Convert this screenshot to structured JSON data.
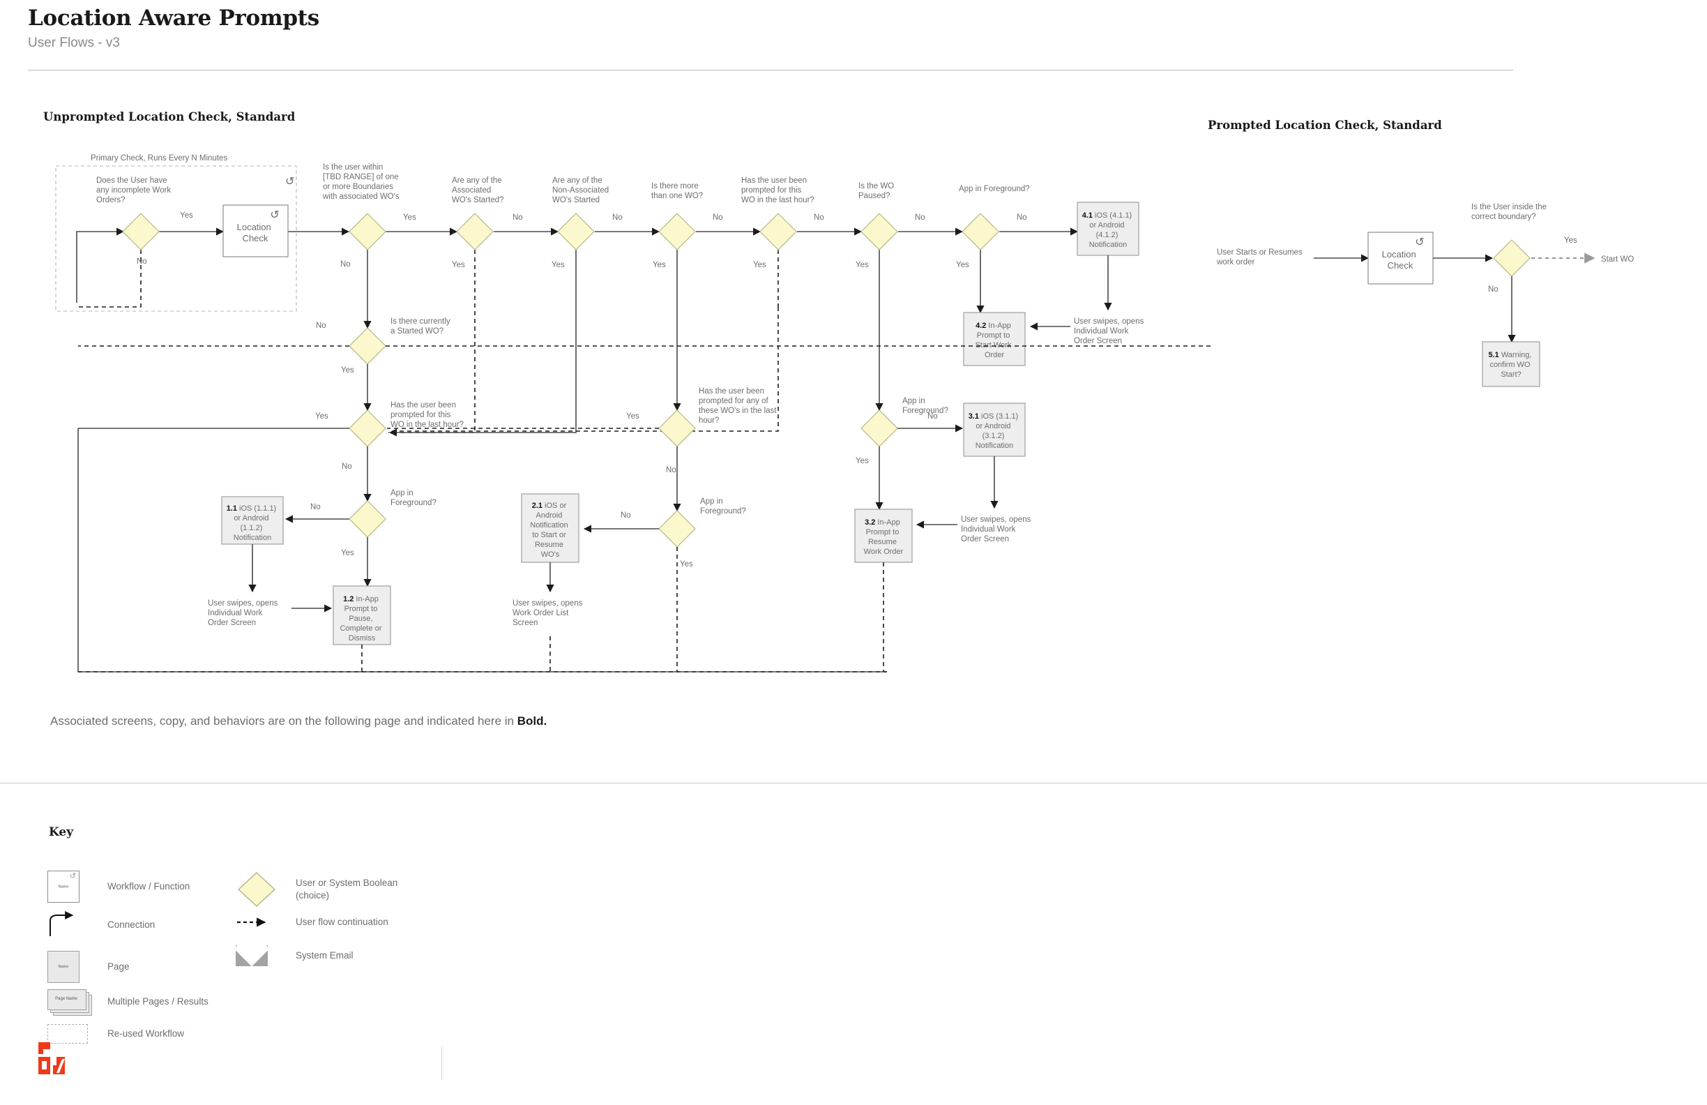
{
  "header": {
    "title": "Location Aware Prompts",
    "subtitle": "User Flows - v3"
  },
  "sections": {
    "unprompted_title": "Unprompted Location Check, Standard",
    "prompted_title": "Prompted Location Check, Standard"
  },
  "footnote": {
    "text": "Associated screens, copy, and behaviors are on the following page and indicated here in ",
    "bold": "Bold."
  },
  "unprompted": {
    "group_label": "Primary Check, Runs Every N Minutes",
    "decisions": {
      "d_incomplete_wo": "Does the User have any incomplete Work Orders?",
      "d_within_range": "Is the user within [TBD RANGE] of one or more Boundaries with associated WO's",
      "d_assoc_started": "Are any of the Associated WO's Started?",
      "d_nonassoc_started": "Are any of the Non-Associated WO's Started",
      "d_more_than_one": "Is there more than one WO?",
      "d_prompted_this_wo_top": "Has the user been prompted for this WO in the last hour?",
      "d_wo_paused": "Is the WO Paused?",
      "d_app_fg_top": "App in Foreground?",
      "d_started_wo": "Is there currently a Started WO?",
      "d_prompted_this_wo_mid": "Has the user been prompted for this WO in the last hour?",
      "d_prompted_any_wo": "Has the user been prompted for any of these WO's in the last hour?",
      "d_app_fg_left": "App in Foreground?",
      "d_app_fg_center": "App in Foreground?",
      "d_app_fg_right": "App in Foreground?"
    },
    "nodes": {
      "location_check": "Location Check"
    },
    "boxes": {
      "b11": {
        "id": "1.1",
        "text": " iOS (1.1.1) or Android (1.1.2) Notification"
      },
      "b12": {
        "id": "1.2",
        "text": " In-App Prompt to Pause, Complete or Dismiss"
      },
      "b21": {
        "id": "2.1",
        "text": " iOS or Android Notification to Start or Resume WO's"
      },
      "b31": {
        "id": "3.1",
        "text": " iOS (3.1.1) or Android (3.1.2) Notification"
      },
      "b32": {
        "id": "3.2",
        "text": " In-App Prompt to Resume Work Order"
      },
      "b41": {
        "id": "4.1",
        "text": " iOS (4.1.1) or Android (4.1.2) Notification"
      },
      "b42": {
        "id": "4.2",
        "text": " In-App Prompt to Start Work Order"
      }
    },
    "annotations": {
      "swipe_individual_1": "User swipes, opens Individual Work Order Screen",
      "swipe_list_2": "User swipes, opens Work Order List Screen",
      "swipe_individual_3": "User swipes, opens Individual Work Order Screen",
      "swipe_individual_4": "User swipes, opens Individual Work Order Screen"
    },
    "edge_labels": {
      "yes": "Yes",
      "no": "No"
    }
  },
  "prompted": {
    "start_label": "User Starts or Resumes work order",
    "node_location_check": "Location Check",
    "decision_boundary": "Is the User inside the correct boundary?",
    "end_label": "Start WO",
    "box_51": {
      "id": "5.1",
      "text": " Warning, confirm WO Start?"
    },
    "edge_labels": {
      "yes": "Yes",
      "no": "No"
    }
  },
  "key": {
    "title": "Key",
    "items": [
      {
        "glyph": "workflow",
        "glyph_name": "Name",
        "label": "Workflow / Function"
      },
      {
        "glyph": "connection",
        "label": "Connection"
      },
      {
        "glyph": "page",
        "glyph_name": "Name",
        "label": "Page"
      },
      {
        "glyph": "multiple-pages",
        "glyph_name": "Page Name",
        "label": "Multiple Pages / Results"
      },
      {
        "glyph": "reused-workflow",
        "label": "Re-used Workflow"
      },
      {
        "glyph": "diamond",
        "label": "User or System Boolean\n(choice)"
      },
      {
        "glyph": "dashed-arrow",
        "label": "User flow continuation"
      },
      {
        "glyph": "envelope",
        "label": "System Email"
      }
    ]
  },
  "colors": {
    "brand": "#ee3a1b",
    "yes": "#3fae52",
    "no": "#c0392b",
    "diamond_fill": "#fbf8cd",
    "box_fill": "#eeeeee"
  }
}
